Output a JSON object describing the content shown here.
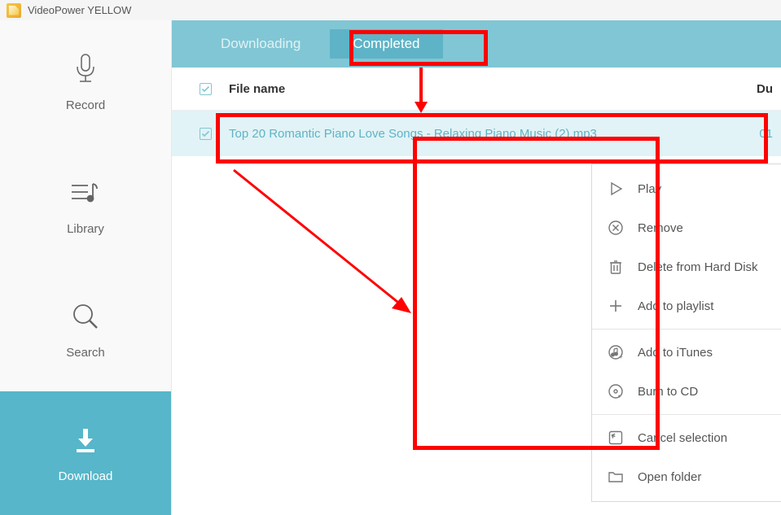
{
  "app": {
    "title": "VideoPower YELLOW"
  },
  "sidebar": {
    "items": [
      {
        "label": "Record",
        "active": false
      },
      {
        "label": "Library",
        "active": false
      },
      {
        "label": "Search",
        "active": false
      },
      {
        "label": "Download",
        "active": true
      }
    ]
  },
  "tabs": {
    "items": [
      {
        "label": "Downloading",
        "active": false
      },
      {
        "label": "Completed",
        "active": true
      }
    ]
  },
  "table": {
    "headers": {
      "filename": "File name",
      "duration": "Du"
    },
    "rows": [
      {
        "filename": "Top 20 Romantic Piano Love Songs - Relaxing Piano Music (2).mp3",
        "duration": "01",
        "checked": true
      }
    ],
    "select_all_checked": true
  },
  "context_menu": {
    "items": [
      {
        "label": "Play",
        "icon": "play"
      },
      {
        "label": "Remove",
        "icon": "remove"
      },
      {
        "label": "Delete from Hard Disk",
        "icon": "trash"
      },
      {
        "label": "Add to playlist",
        "icon": "plus",
        "submenu": true
      },
      {
        "divider": true
      },
      {
        "label": "Add to iTunes",
        "icon": "itunes"
      },
      {
        "label": "Burn to CD",
        "icon": "cd"
      },
      {
        "divider": true
      },
      {
        "label": "Cancel selection",
        "icon": "cancel"
      },
      {
        "label": "Open folder",
        "icon": "folder"
      }
    ]
  }
}
